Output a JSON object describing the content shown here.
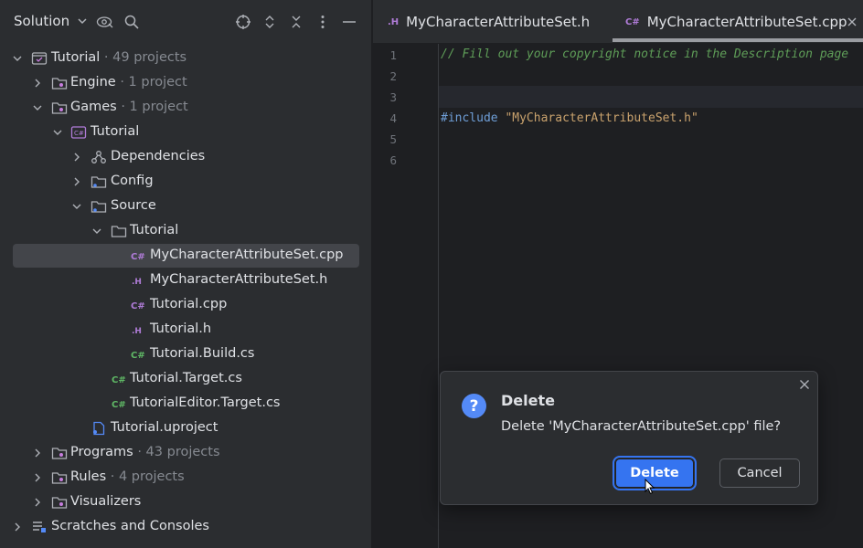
{
  "sidebar": {
    "title": "Solution",
    "tree": [
      {
        "label": "Tutorial",
        "meta": "· 49 projects",
        "expanded": true,
        "icon": "solution-icon"
      },
      {
        "label": "Engine",
        "meta": "· 1 project",
        "expanded": false,
        "icon": "folder-icon"
      },
      {
        "label": "Games",
        "meta": "· 1 project",
        "expanded": true,
        "icon": "folder-icon"
      },
      {
        "label": "Tutorial",
        "meta": "",
        "expanded": true,
        "icon": "cpp-project-icon"
      },
      {
        "label": "Dependencies",
        "meta": "",
        "expanded": false,
        "icon": "dependencies-icon"
      },
      {
        "label": "Config",
        "meta": "",
        "expanded": false,
        "icon": "folder-icon"
      },
      {
        "label": "Source",
        "meta": "",
        "expanded": true,
        "icon": "folder-icon"
      },
      {
        "label": "Tutorial",
        "meta": "",
        "expanded": true,
        "icon": "folder-icon"
      },
      {
        "label": "MyCharacterAttributeSet.cpp",
        "meta": "",
        "icon": "cpp-file-icon"
      },
      {
        "label": "MyCharacterAttributeSet.h",
        "meta": "",
        "icon": "header-file-icon"
      },
      {
        "label": "Tutorial.cpp",
        "meta": "",
        "icon": "cpp-file-icon"
      },
      {
        "label": "Tutorial.h",
        "meta": "",
        "icon": "header-file-icon"
      },
      {
        "label": "Tutorial.Build.cs",
        "meta": "",
        "icon": "csharp-file-icon"
      },
      {
        "label": "Tutorial.Target.cs",
        "meta": "",
        "icon": "csharp-file-icon"
      },
      {
        "label": "TutorialEditor.Target.cs",
        "meta": "",
        "icon": "csharp-file-icon"
      },
      {
        "label": "Tutorial.uproject",
        "meta": "",
        "icon": "uproject-icon"
      },
      {
        "label": "Programs",
        "meta": "· 43 projects",
        "expanded": false,
        "icon": "folder-icon"
      },
      {
        "label": "Rules",
        "meta": "· 4 projects",
        "expanded": false,
        "icon": "folder-icon"
      },
      {
        "label": "Visualizers",
        "meta": "",
        "expanded": false,
        "icon": "folder-icon"
      },
      {
        "label": "Scratches and Consoles",
        "meta": "",
        "expanded": false,
        "icon": "scratches-icon"
      }
    ]
  },
  "editor": {
    "tabs": [
      {
        "ext": ".H",
        "label": "MyCharacterAttributeSet.h"
      },
      {
        "ext": "C#",
        "label": "MyCharacterAttributeSet.cpp"
      }
    ],
    "lines": [
      "1",
      "2",
      "3",
      "4",
      "5",
      "6"
    ],
    "code": {
      "line1_comment": "// Fill out your copyright notice in the Description page",
      "line4_directive": "#include",
      "line4_string": "\"MyCharacterAttributeSet.h\""
    }
  },
  "dialog": {
    "icon": "?",
    "title": "Delete",
    "message": "Delete 'MyCharacterAttributeSet.cpp' file?",
    "confirm_label": "Delete",
    "cancel_label": "Cancel"
  }
}
